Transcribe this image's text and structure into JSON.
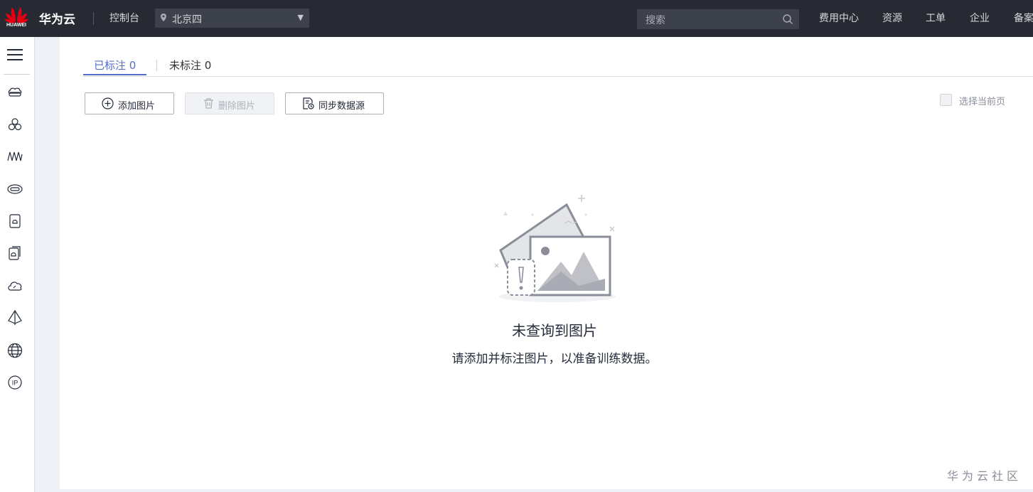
{
  "header": {
    "logo_text": "HUAWEI",
    "brand": "华为云",
    "console": "控制台",
    "region": "北京四",
    "search_placeholder": "搜索",
    "nav": [
      "费用中心",
      "资源",
      "工单",
      "企业",
      "备案"
    ]
  },
  "sidebar": {
    "menu_icon": "hamburger-menu-icon",
    "items": [
      {
        "icon": "cloud-server-icon"
      },
      {
        "icon": "cluster-nodes-icon"
      },
      {
        "icon": "waveform-icon"
      },
      {
        "icon": "storage-disk-icon"
      },
      {
        "icon": "database-box-icon"
      },
      {
        "icon": "backup-box-icon"
      },
      {
        "icon": "cloud-gauge-icon"
      },
      {
        "icon": "network-pyramid-icon"
      },
      {
        "icon": "globe-icon"
      },
      {
        "icon": "ip-icon"
      }
    ]
  },
  "tabs": [
    {
      "label": "已标注 0",
      "active": true
    },
    {
      "label": "未标注 0",
      "active": false
    }
  ],
  "toolbar": {
    "add_label": "添加图片",
    "delete_label": "删除图片",
    "sync_label": "同步数据源",
    "select_page_label": "选择当前页"
  },
  "empty": {
    "title": "未查询到图片",
    "description": "请添加并标注图片，以准备训练数据。"
  },
  "watermark": "华为云社区",
  "colors": {
    "topbar": "#272a33",
    "accent": "#526ecc",
    "page_bg": "#eff0f5"
  }
}
